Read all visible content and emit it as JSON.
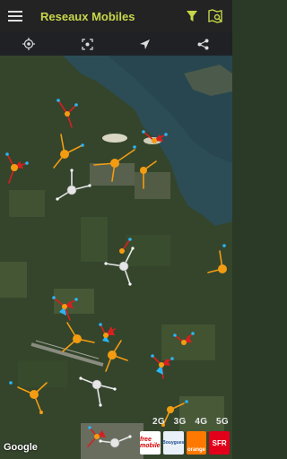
{
  "app": {
    "title": "Reseaux Mobiles",
    "icons": {
      "menu": "hamburger-menu-icon",
      "filter": "filter-icon",
      "map_search": "map-search-icon"
    }
  },
  "toolbar": {
    "tools": [
      "my-location-icon",
      "fit-view-icon",
      "navigation-arrow-icon",
      "share-icon"
    ]
  },
  "map": {
    "attribution": "Google",
    "tech_legend": [
      "2G",
      "3G",
      "4G",
      "5G"
    ],
    "operators": [
      "free mobile",
      "Bouygues",
      "orange",
      "SFR"
    ]
  },
  "colors": {
    "accent": "#c7d64a",
    "antenna_orange": "#f39c12",
    "antenna_white": "#e6e6e6",
    "beam_red": "#d62020",
    "beam_cyan": "#29b6f6"
  }
}
